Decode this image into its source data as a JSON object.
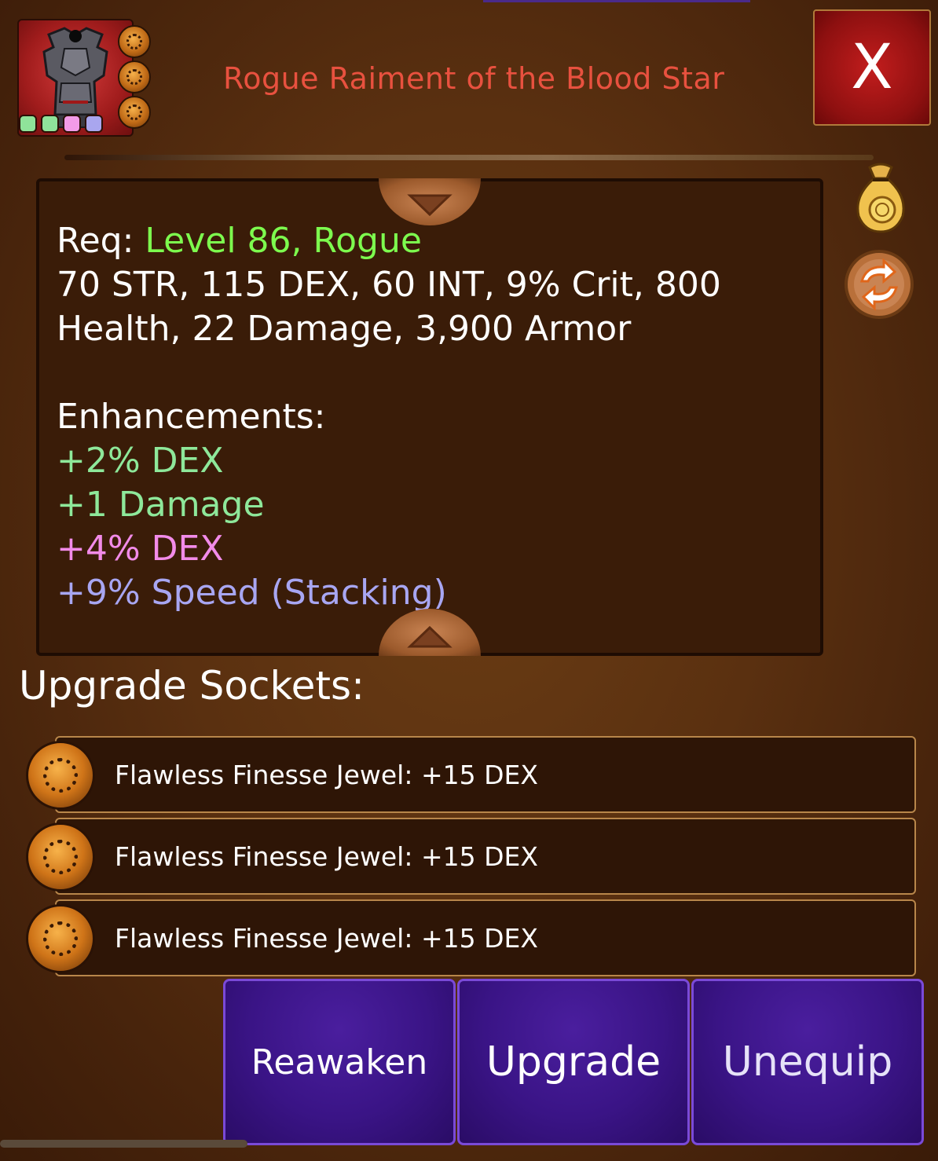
{
  "item": {
    "name": "Rogue Raiment of the Blood Star",
    "icon": "armor-chest-icon",
    "socket_dot_colors": [
      "#8fe39a",
      "#8fe39a",
      "#f39be8",
      "#a9a6ef"
    ]
  },
  "close_label": "X",
  "stats": {
    "req_prefix": "Req: ",
    "req_value": "Level 86, Rogue",
    "line2": "70 STR, 115 DEX, 60 INT, 9% Crit, 800",
    "line3": "Health, 22 Damage, 3,900 Armor",
    "enhancements_title": "Enhancements:",
    "enhancements": [
      {
        "text": "+2% DEX",
        "color": "#8ee89a"
      },
      {
        "text": "+1 Damage",
        "color": "#8ee89a"
      },
      {
        "text": "+4% DEX",
        "color": "#f28be9"
      },
      {
        "text": "+9% Speed (Stacking)",
        "color": "#a8a6f2"
      }
    ]
  },
  "side_icons": [
    "gold-pouch-icon",
    "swap-icon"
  ],
  "sockets": {
    "title": "Upgrade Sockets:",
    "rows": [
      {
        "label": "Flawless Finesse Jewel: +15 DEX"
      },
      {
        "label": "Flawless Finesse Jewel: +15 DEX"
      },
      {
        "label": "Flawless Finesse Jewel: +15 DEX"
      }
    ]
  },
  "buttons": {
    "reawaken": "Reawaken",
    "upgrade": "Upgrade",
    "unequip": "Unequip"
  }
}
